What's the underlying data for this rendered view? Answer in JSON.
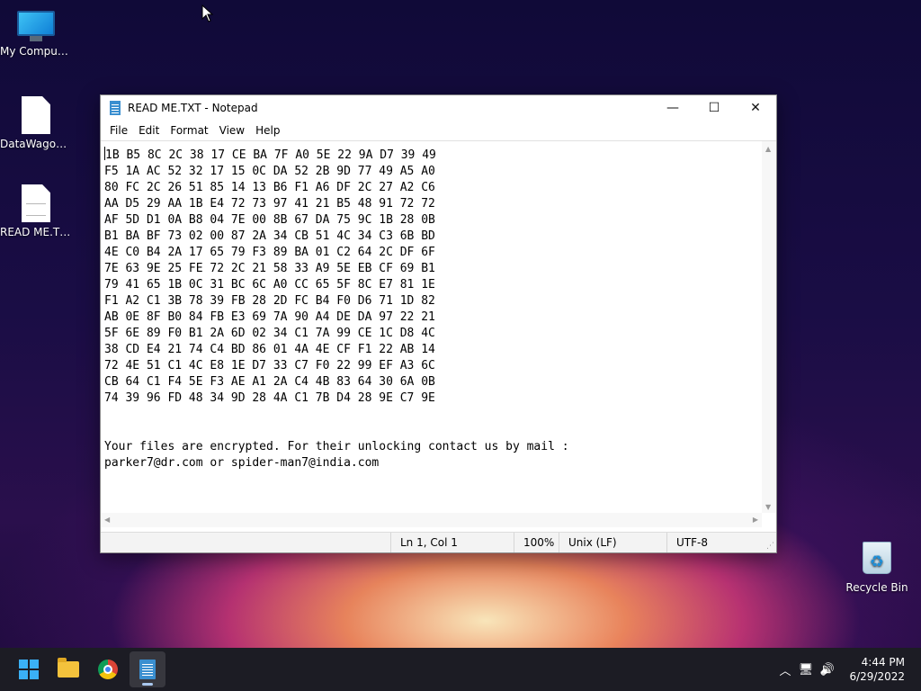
{
  "desktop": {
    "icons": [
      {
        "label": "My Computer",
        "icon": "computer-icon"
      },
      {
        "label": "DataWagon....",
        "icon": "file-icon"
      },
      {
        "label": "READ ME.TXT",
        "icon": "text-file-icon"
      },
      {
        "label": "Recycle Bin",
        "icon": "recycle-bin-icon"
      }
    ]
  },
  "window": {
    "title": "READ ME.TXT - Notepad",
    "controls": {
      "minimize": "—",
      "maximize": "☐",
      "close": "✕"
    },
    "menu": [
      "File",
      "Edit",
      "Format",
      "View",
      "Help"
    ],
    "content": "1B B5 8C 2C 38 17 CE BA 7F A0 5E 22 9A D7 39 49\nF5 1A AC 52 32 17 15 0C DA 52 2B 9D 77 49 A5 A0\n80 FC 2C 26 51 85 14 13 B6 F1 A6 DF 2C 27 A2 C6\nAA D5 29 AA 1B E4 72 73 97 41 21 B5 48 91 72 72\nAF 5D D1 0A B8 04 7E 00 8B 67 DA 75 9C 1B 28 0B\nB1 BA BF 73 02 00 87 2A 34 CB 51 4C 34 C3 6B BD\n4E C0 B4 2A 17 65 79 F3 89 BA 01 C2 64 2C DF 6F\n7E 63 9E 25 FE 72 2C 21 58 33 A9 5E EB CF 69 B1\n79 41 65 1B 0C 31 BC 6C A0 CC 65 5F 8C E7 81 1E\nF1 A2 C1 3B 78 39 FB 28 2D FC B4 F0 D6 71 1D 82\nAB 0E 8F B0 84 FB E3 69 7A 90 A4 DE DA 97 22 21\n5F 6E 89 F0 B1 2A 6D 02 34 C1 7A 99 CE 1C D8 4C\n38 CD E4 21 74 C4 BD 86 01 4A 4E CF F1 22 AB 14\n72 4E 51 C1 4C E8 1E D7 33 C7 F0 22 99 EF A3 6C\nCB 64 C1 F4 5E F3 AE A1 2A C4 4B 83 64 30 6A 0B\n74 39 96 FD 48 34 9D 28 4A C1 7B D4 28 9E C7 9E\n\n\nYour files are encrypted. For their unlocking contact us by mail :\nparker7@dr.com or spider-man7@india.com",
    "status": {
      "position": "Ln 1, Col 1",
      "zoom": "100%",
      "line_ending": "Unix (LF)",
      "encoding": "UTF-8"
    }
  },
  "taskbar": {
    "apps": [
      "start-icon",
      "file-explorer-icon",
      "chrome-icon",
      "notepad-icon"
    ],
    "tray": {
      "chevron": "︿",
      "network": "🖥",
      "volume": "🔊"
    },
    "clock": {
      "time": "4:44 PM",
      "date": "6/29/2022"
    }
  }
}
